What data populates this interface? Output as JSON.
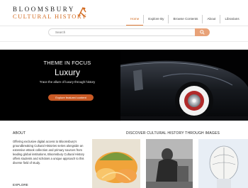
{
  "brand": {
    "line1": "BLOOMSBURY",
    "line2": "CULTURAL HISTORY",
    "accent": "#d2691e"
  },
  "nav": {
    "items": [
      {
        "label": "Home",
        "active": true
      },
      {
        "label": "Explore By",
        "active": false
      },
      {
        "label": "Browse Contents",
        "active": false
      },
      {
        "label": "About",
        "active": false
      },
      {
        "label": "Librarians",
        "active": false
      }
    ]
  },
  "search": {
    "placeholder": "Search",
    "button_icon": "search-icon"
  },
  "hero": {
    "eyebrow": "THEME IN FOCUS",
    "title": "Luxury",
    "subtitle": "Trace the allure of luxury through history",
    "button_label": "Explore featured content",
    "button_color": "#c95a25"
  },
  "about": {
    "heading": "ABOUT",
    "body": "Offering exclusive digital access to Bloomsbury's groundbreaking Cultural Histories series alongside an extensive eBook collection and primary sources from leading global institutions, Bloomsbury Cultural History offers students and scholars a unique approach to this diverse field of study."
  },
  "explore": {
    "heading": "EXPLORE"
  },
  "discover": {
    "heading": "DISCOVER CULTURAL HISTORY THROUGH IMAGES",
    "images": [
      {
        "subject": "cut melons"
      },
      {
        "subject": "seated woman in black-and-white photograph"
      },
      {
        "subject": "phrenology head"
      }
    ]
  }
}
